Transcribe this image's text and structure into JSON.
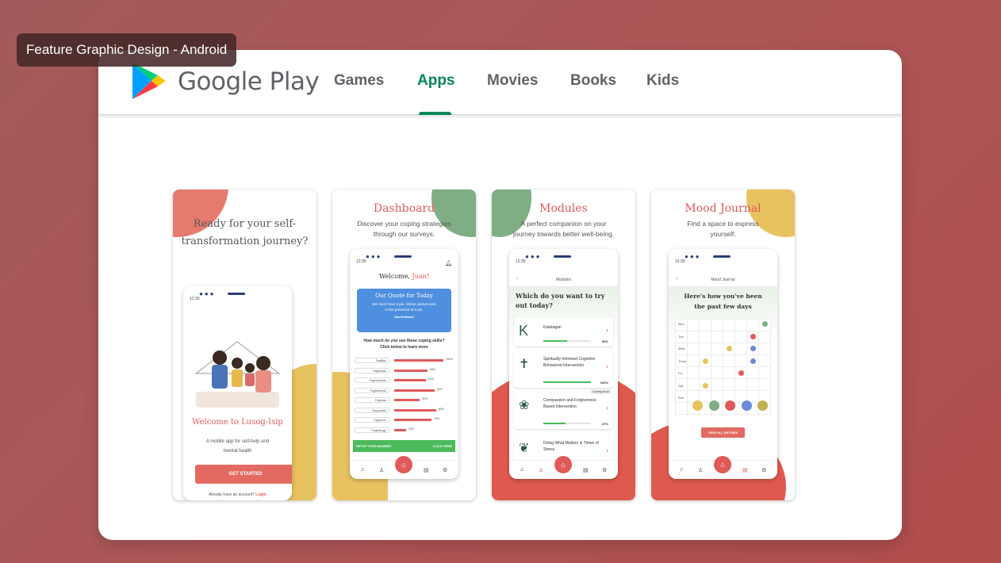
{
  "overlay_tag": "Feature Graphic Design - Android",
  "store": {
    "brand": "Google Play",
    "nav": [
      "Games",
      "Apps",
      "Movies",
      "Books",
      "Kids"
    ],
    "active_tab": "Apps"
  },
  "screens": {
    "s1": {
      "headline": "Ready for your self-transformation journey?",
      "time": "12:30",
      "welcome": "Welcome to Lusog-Isip",
      "desc": "A mobile app for self-help and mental health",
      "button": "GET STARTED",
      "account_prompt": "Already have an account?",
      "login": "Login"
    },
    "s2": {
      "title": "Dashboard",
      "subtitle": "Discover your coping strategies through our surveys.",
      "time": "12:30",
      "welcome_prefix": "Welcome, ",
      "welcome_name": "Juan!",
      "quote_title": "Our Quote for Today",
      "quote_text": "We must have a pie. Stress cannot exist in the presence of a pie.",
      "quote_author": "David Mamet",
      "question": "How much do you use these coping skills? Click below to learn more",
      "bars": [
        {
          "label": "Pagtitiyo",
          "value": 100,
          "text": "100%"
        },
        {
          "label": "Pagtitiwala",
          "value": 68,
          "text": "68%"
        },
        {
          "label": "Pagrerebelde",
          "value": 64,
          "text": "64%"
        },
        {
          "label": "Pagtatahimik",
          "value": 82,
          "text": "82%"
        },
        {
          "label": "Pagiiwas",
          "value": 52,
          "text": "52%"
        },
        {
          "label": "Pagsasalita",
          "value": 85,
          "text": "85%"
        },
        {
          "label": "Pagtutuon",
          "value": 76,
          "text": "76%"
        },
        {
          "label": "Pagtatanggi",
          "value": 24,
          "text": "24%"
        }
      ],
      "banner": "SETUP YOUR BANNER",
      "banner_action": "CLICK HERE"
    },
    "s3": {
      "title": "Modules",
      "subtitle": "A perfect companion on your journey towards better well-being.",
      "time": "12:30",
      "header": "Modules",
      "question": "Which do you want to try out today?",
      "modules": [
        {
          "icon": "K",
          "name": "Katatagan",
          "progress": 50,
          "text": "50%",
          "badge": ""
        },
        {
          "icon": "✝",
          "name": "Spiritually-Informed Cognitive Behavioral Intervention",
          "progress": 100,
          "text": "100%",
          "badge": ""
        },
        {
          "icon": "❀",
          "name": "Compassion and Forgiveness-Based Intervention",
          "progress": 47,
          "text": "47%",
          "badge": "Coming Soon"
        },
        {
          "icon": "❦",
          "name": "Doing What Matters in Times of Stress",
          "progress": 0,
          "text": "",
          "badge": ""
        }
      ]
    },
    "s4": {
      "title": "Mood Journal",
      "subtitle": "Find a space to express yourself.",
      "time": "12:30",
      "header": "Mood Journal",
      "prompt": "Here's how you've been the past few days",
      "days": [
        "Mon",
        "Tue",
        "Wed",
        "Thurs",
        "Fri",
        "Sat",
        "Sun"
      ],
      "moods": [
        "😊",
        "😐",
        "😡",
        "😨",
        "🤢"
      ],
      "button": "VIEW ALL ENTRIES"
    }
  },
  "colors": {
    "accent": "#e05a5a",
    "green": "#01875f",
    "sage": "#7fae84",
    "mustard": "#e8c25e"
  }
}
